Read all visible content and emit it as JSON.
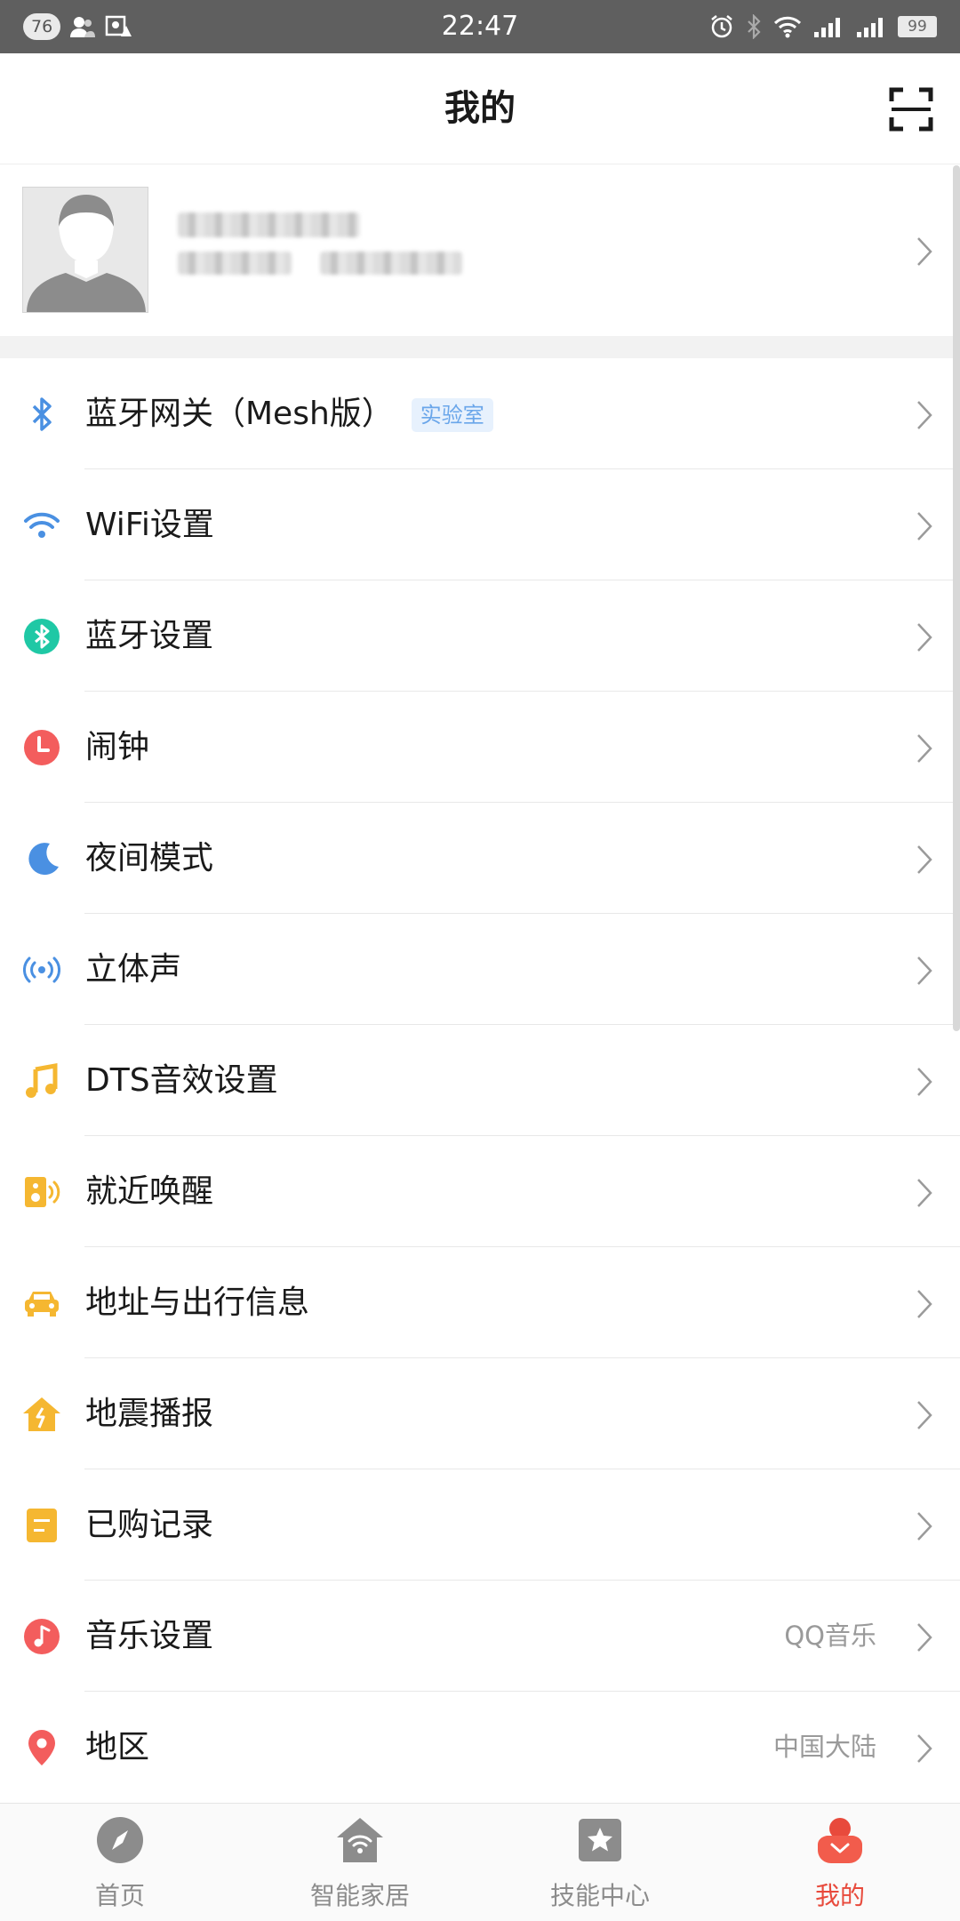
{
  "status_bar": {
    "badge": "76",
    "time": "22:47",
    "battery": "99"
  },
  "header": {
    "title": "我的"
  },
  "menu": {
    "items": [
      {
        "label": "蓝牙网关（Mesh版）",
        "tag": "实验室",
        "icon": "bluetooth-icon",
        "color": "#4a90e2"
      },
      {
        "label": "WiFi设置",
        "icon": "wifi-icon",
        "color": "#4a90e2"
      },
      {
        "label": "蓝牙设置",
        "icon": "bluetooth-circle-icon",
        "color": "#1fc8a5"
      },
      {
        "label": "闹钟",
        "icon": "alarm-clock-icon",
        "color": "#f35d5d"
      },
      {
        "label": "夜间模式",
        "icon": "moon-icon",
        "color": "#4a90e2"
      },
      {
        "label": "立体声",
        "icon": "stereo-icon",
        "color": "#4a90e2"
      },
      {
        "label": "DTS音效设置",
        "icon": "music-note-icon",
        "color": "#f5b731"
      },
      {
        "label": "就近唤醒",
        "icon": "speaker-icon",
        "color": "#f5b731"
      },
      {
        "label": "地址与出行信息",
        "icon": "car-icon",
        "color": "#f5b731"
      },
      {
        "label": "地震播报",
        "icon": "earthquake-house-icon",
        "color": "#f5b731"
      },
      {
        "label": "已购记录",
        "icon": "receipt-icon",
        "color": "#f5b731"
      },
      {
        "label": "音乐设置",
        "value": "QQ音乐",
        "icon": "music-circle-icon",
        "color": "#f35d5d"
      },
      {
        "label": "地区",
        "value": "中国大陆",
        "icon": "location-pin-icon",
        "color": "#f35d5d"
      }
    ]
  },
  "bottom_nav": {
    "items": [
      {
        "label": "首页",
        "icon": "compass-icon",
        "active": false
      },
      {
        "label": "智能家居",
        "icon": "smart-home-icon",
        "active": false
      },
      {
        "label": "技能中心",
        "icon": "star-box-icon",
        "active": false
      },
      {
        "label": "我的",
        "icon": "profile-icon",
        "active": true
      }
    ],
    "active_color": "#e84a3c",
    "inactive_color": "#8c8c8c"
  }
}
